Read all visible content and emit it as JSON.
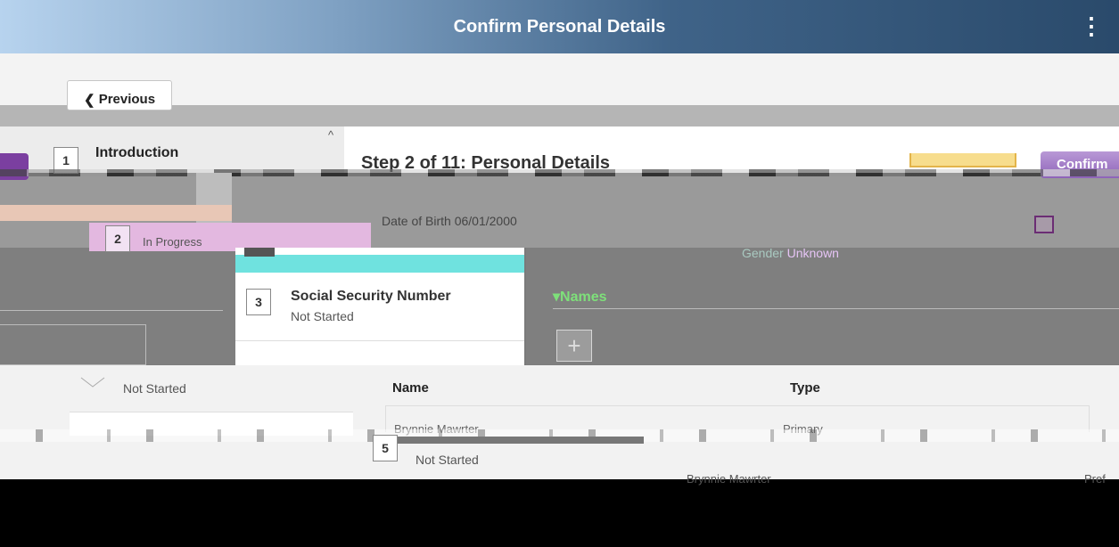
{
  "header": {
    "title": "Confirm Personal Details",
    "menu_icon": "kebab-menu-icon"
  },
  "nav": {
    "previous_label": "Previous",
    "confirm_label": "Confirm"
  },
  "steps": [
    {
      "number": "1",
      "title": "Introduction"
    },
    {
      "number": "2",
      "status": "In Progress"
    },
    {
      "number": "3",
      "title": "Social Security Number",
      "status": "Not Started"
    },
    {
      "status": "Not Started"
    },
    {
      "number": "5",
      "status": "Not Started"
    }
  ],
  "main": {
    "heading": "Step 2 of 11: Personal Details",
    "dob_label": "Date of Birth",
    "dob_value": "06/01/2000",
    "gender_label": "Gender",
    "gender_value": "Unknown",
    "names_section": "Names",
    "add_icon": "+"
  },
  "names_table": {
    "columns": [
      "Name",
      "Type"
    ],
    "rows": [
      {
        "name": "Brynnie Mawrter",
        "type": "Primary"
      },
      {
        "name": "Brynnie Mawrter",
        "type": "Pref"
      }
    ]
  },
  "colors": {
    "header_dark": "#2a4a6b",
    "accent_purple": "#8e63b9",
    "names_green": "#7ee07a"
  }
}
